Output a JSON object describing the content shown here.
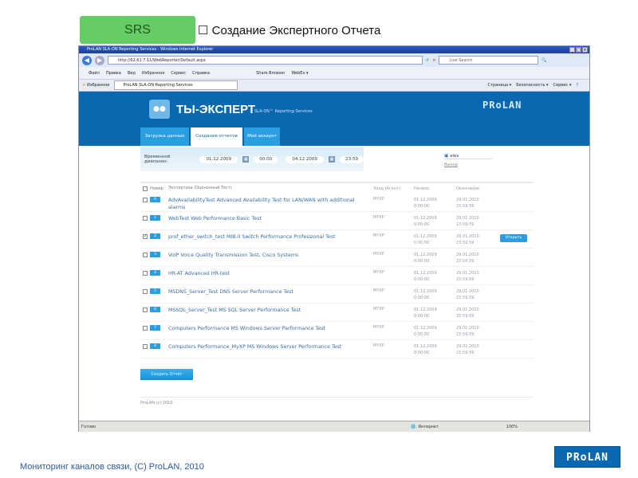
{
  "slide": {
    "badge": "SRS",
    "title": "☐ Создание Экспертного Отчета",
    "footer": "Мониторинг каналов связи, (С) ProLAN, 2010",
    "logo": "PRoLAN"
  },
  "browser": {
    "title": "ProLAN SLA-ON Reporting Services - Windows Internet Explorer",
    "url": "http://62.61.7.11/WebReporter/Default.aspx",
    "search_placeholder": "Live Search",
    "menu": [
      "Файл",
      "Правка",
      "Вид",
      "Избранное",
      "Сервис",
      "Справка"
    ],
    "toolbar_extra": [
      "Share Browser",
      "WebEx ▾"
    ],
    "favorites": "Избранное",
    "tab": "ProLAN SLA-ON Reporting Services",
    "commands": [
      "Страница ▾",
      "Безопасность ▾",
      "Сервис ▾"
    ],
    "status": "Готово",
    "zone": "Интернет",
    "zoom": "100%"
  },
  "app": {
    "brand": "ТЫ-ЭКСПЕРТ",
    "brand_sub": "SLA-ON™ Reporting Services",
    "logo": "PRoLAN",
    "tabs": [
      {
        "label": "Загрузка данных"
      },
      {
        "label": "Создание отчетов",
        "active": true
      },
      {
        "label": "Мой аккаунт"
      }
    ],
    "filter": {
      "label": "Временной диапазон:",
      "date_from": "01.12.2009",
      "time_from": "00:00",
      "date_to": "04.12.2009",
      "time_to": "23:59"
    },
    "user": "alex",
    "logout": "Выход",
    "table": {
      "headers": [
        "Номер",
        "Экспертиза (Оценочный Тест)",
        "Зонд (Агент)",
        "Начало",
        "Окончание"
      ],
      "rows": [
        {
          "num": "0",
          "name": "AdvAvailabilityTest Advanced Availability Test for LAN/WAN with additional alarms",
          "agent": "MYXP",
          "start_date": "01.12.2009",
          "start_time": "0:00:00",
          "end_date": "29.01.2010",
          "end_time": "23:59:59",
          "checked": false
        },
        {
          "num": "1",
          "name": "WebTest Web Performance Basic Test",
          "agent": "MYXP",
          "start_date": "01.12.2009",
          "start_time": "0:00:00",
          "end_date": "29.01.2010",
          "end_time": "23:59:59",
          "checked": false
        },
        {
          "num": "2",
          "name": "prof_ether_switch_test MIB-II Switch Performance Professional Test",
          "agent": "MYXP",
          "start_date": "01.12.2009",
          "start_time": "0:00:00",
          "end_date": "29.01.2010",
          "end_time": "23:59:59",
          "checked": true,
          "action": "Открыть"
        },
        {
          "num": "3",
          "name": "VoIP Voice Quality Transmission Test, Cisco Systems",
          "agent": "MYXP",
          "start_date": "01.12.2009",
          "start_time": "0:00:00",
          "end_date": "29.01.2010",
          "end_time": "23:59:59",
          "checked": false
        },
        {
          "num": "4",
          "name": "HR-AT Advanced HR-test",
          "agent": "MYXP",
          "start_date": "01.12.2009",
          "start_time": "0:00:00",
          "end_date": "29.01.2010",
          "end_time": "23:59:59",
          "checked": false
        },
        {
          "num": "5",
          "name": "MSDNS_Server_Test DNS Server Performance Test",
          "agent": "MYXP",
          "start_date": "01.12.2009",
          "start_time": "0:00:00",
          "end_date": "29.01.2010",
          "end_time": "23:59:59",
          "checked": false
        },
        {
          "num": "6",
          "name": "MSSQL_Server_Test MS SQL Server Performance Test",
          "agent": "MYXP",
          "start_date": "01.12.2009",
          "start_time": "0:00:00",
          "end_date": "29.01.2010",
          "end_time": "23:59:59",
          "checked": false
        },
        {
          "num": "7",
          "name": "Computers Performance MS Windows Server Performance Test",
          "agent": "MYXP",
          "start_date": "01.12.2009",
          "start_time": "0:00:00",
          "end_date": "29.01.2010",
          "end_time": "23:59:59",
          "checked": false
        },
        {
          "num": "8",
          "name": "Computers Performance_MyXP MS Windows Server Performance Test",
          "agent": "MYXP",
          "start_date": "01.12.2009",
          "start_time": "0:00:00",
          "end_date": "29.01.2010",
          "end_time": "23:59:59",
          "checked": false
        }
      ]
    },
    "create_button": "Создать Отчет",
    "copyright": "ProLAN (c) 2010"
  },
  "colors": {
    "brand_blue": "#0a68b0",
    "accent": "#2a9ee0",
    "srs_green": "#66cc66"
  }
}
